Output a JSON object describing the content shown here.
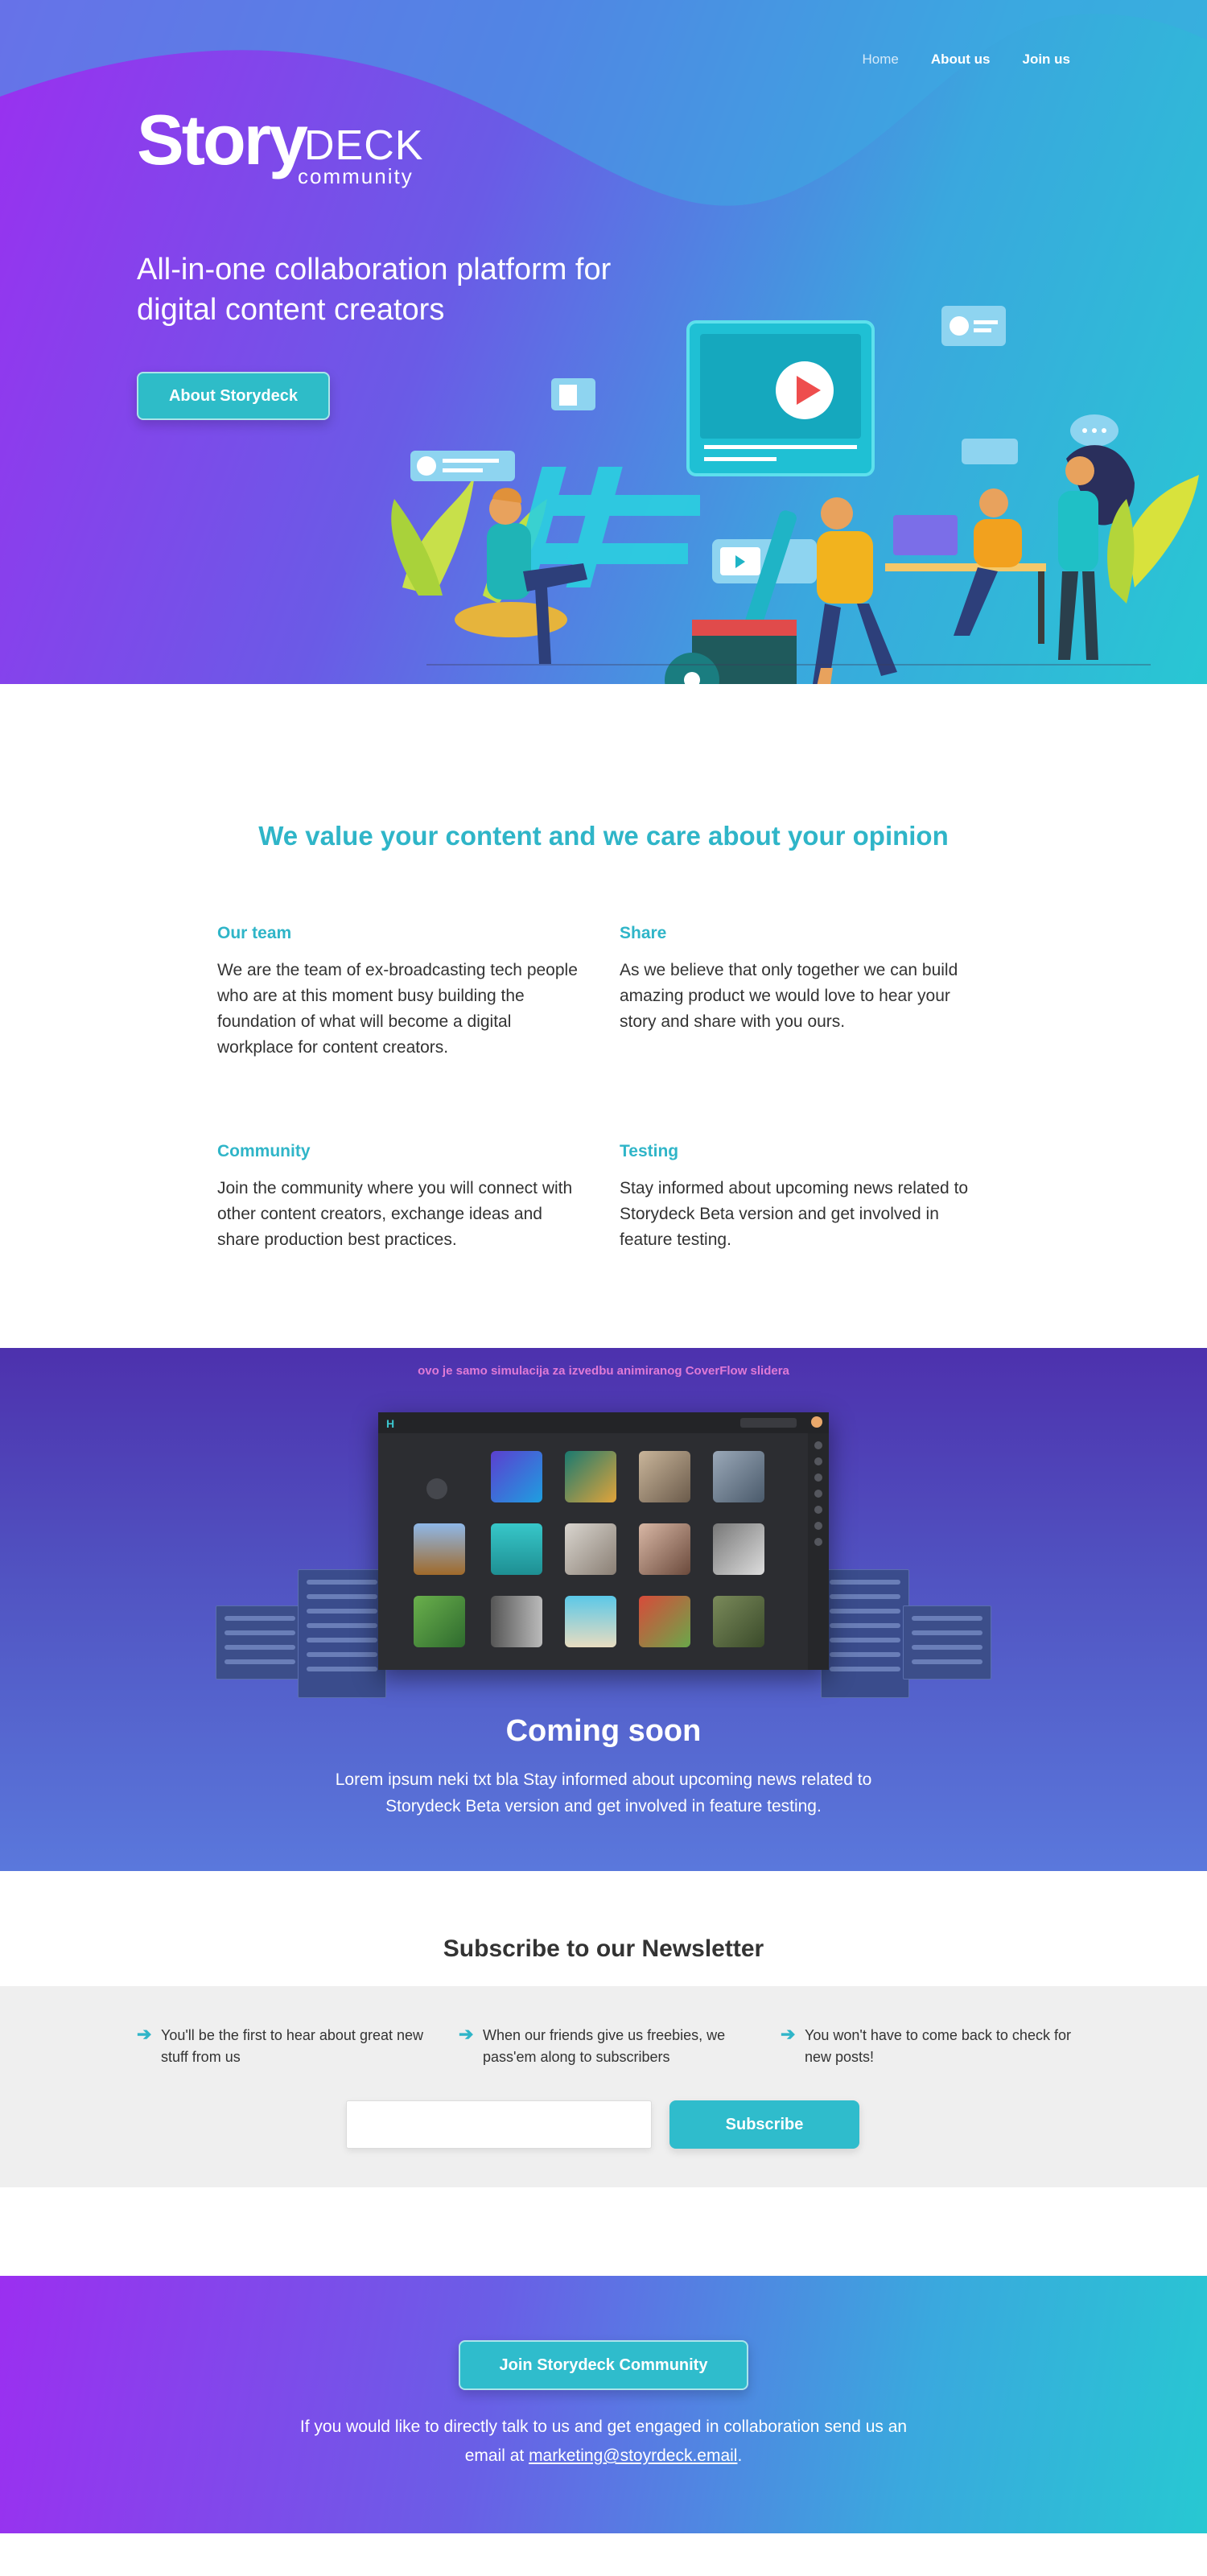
{
  "nav": {
    "home": "Home",
    "about": "About us",
    "join": "Join us"
  },
  "logo": {
    "story": "Story",
    "deck": "DECK",
    "community": "community"
  },
  "hero": {
    "tagline": "All-in-one collaboration platform for digital content creators",
    "cta": "About Storydeck"
  },
  "values": {
    "title": "We value your content and we care about your opinion",
    "items": [
      {
        "title": "Our team",
        "text": "We are the team of ex-broadcasting tech people who are at this moment busy building the foundation of what will become a digital workplace for content creators."
      },
      {
        "title": "Share",
        "text": "As we believe that only together we can build amazing product we would love to hear your story and share with you ours."
      },
      {
        "title": "Community",
        "text": "Join the community where you will connect with other content creators, exchange ideas and share production best practices."
      },
      {
        "title": "Testing",
        "text": "Stay informed about upcoming news related to Storydeck Beta version and get involved in feature testing."
      }
    ]
  },
  "coming": {
    "note": "ovo je samo simulacija za izvedbu animiranog CoverFlow slidera",
    "title": "Coming soon",
    "text": "Lorem ipsum neki txt  bla Stay informed about upcoming news related to Storydeck Beta version and get involved in feature testing."
  },
  "newsletter": {
    "title": "Subscribe to our Newsletter",
    "bullets": [
      "You'll be the first to hear about great new stuff from us",
      "When our friends give us freebies, we pass'em along to subscribers",
      "You won't have to come back to check for new posts!"
    ],
    "email_placeholder": "",
    "button": "Subscribe"
  },
  "cta": {
    "button": "Join Storydeck Community",
    "text": "If you would like to directly talk to us and get engaged in collaboration send us an email at",
    "email": "marketing@stoyrdeck.email",
    "suffix": "."
  },
  "colors": {
    "accent": "#2fb5c8",
    "purple": "#9b2ff0",
    "cyan": "#28c7d3"
  }
}
